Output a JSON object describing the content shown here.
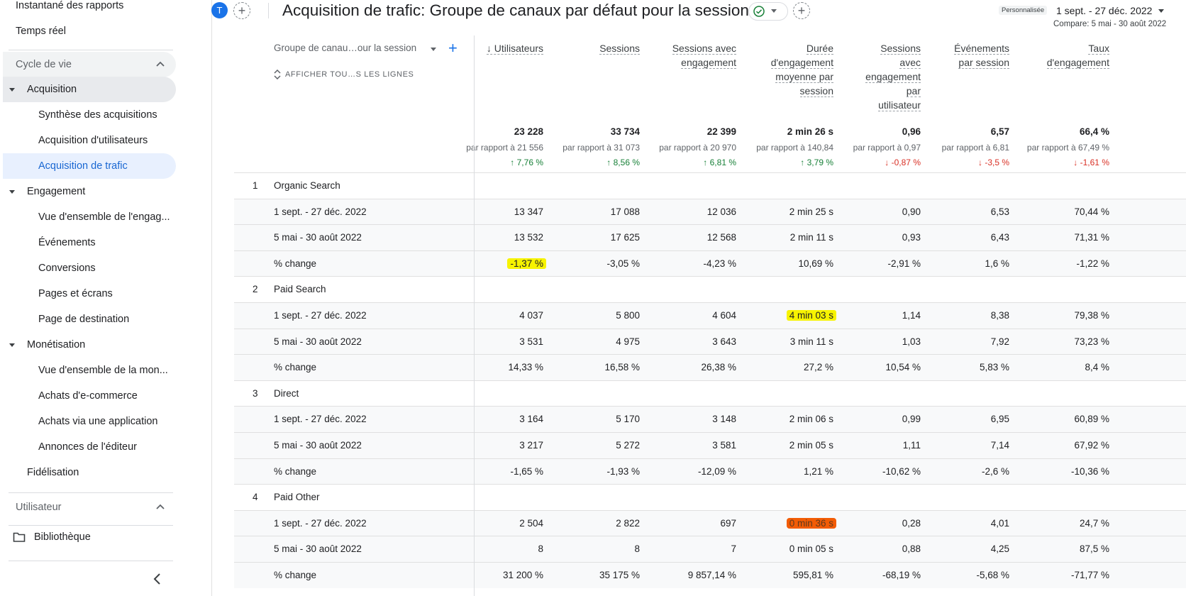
{
  "sidebar": {
    "top_items": [
      "Instantané des rapports",
      "Temps réel"
    ],
    "lifecycle_section": "Cycle de vie",
    "acquisition": "Acquisition",
    "acquisition_items": [
      "Synthèse des acquisitions",
      "Acquisition d'utilisateurs",
      "Acquisition de trafic"
    ],
    "engagement": "Engagement",
    "engagement_items": [
      "Vue d'ensemble de l'engag...",
      "Événements",
      "Conversions",
      "Pages et écrans",
      "Page de destination"
    ],
    "monetisation": "Monétisation",
    "monetisation_items": [
      "Vue d'ensemble de la mon...",
      "Achats d'e-commerce",
      "Achats via une application",
      "Annonces de l'éditeur"
    ],
    "fidelisation": "Fidélisation",
    "user_section": "Utilisateur",
    "library": "Bibliothèque"
  },
  "header": {
    "avatar_letter": "T",
    "title": "Acquisition de trafic: Groupe de canaux par défaut pour la session",
    "custom_chip": "Personnalisée",
    "date_range": "1 sept. - 27 déc. 2022",
    "compare": "Compare: 5 mai - 30 août 2022"
  },
  "table": {
    "dimension_header": "Groupe de canau…our la session",
    "show_all": "AFFICHER TOU…S LES LIGNES",
    "metrics": [
      {
        "lines": [
          "↓ Utilisateurs"
        ],
        "total": "23 228",
        "compare": "par rapport à 21 556",
        "delta": "↑ 7,76 %",
        "dir": "up"
      },
      {
        "lines": [
          "Sessions"
        ],
        "total": "33 734",
        "compare": "par rapport à 31 073",
        "delta": "↑ 8,56 %",
        "dir": "up"
      },
      {
        "lines": [
          "Sessions avec",
          "engagement"
        ],
        "total": "22 399",
        "compare": "par rapport à 20 970",
        "delta": "↑ 6,81 %",
        "dir": "up"
      },
      {
        "lines": [
          "Durée",
          "d'engagement",
          "moyenne par",
          "session"
        ],
        "total": "2 min 26 s",
        "compare": "par rapport à 140,84",
        "delta": "↑ 3,79 %",
        "dir": "up"
      },
      {
        "lines": [
          "Sessions",
          "avec",
          "engagement",
          "par",
          "utilisateur"
        ],
        "total": "0,96",
        "compare": "par rapport à 0,97",
        "delta": "↓ -0,87 %",
        "dir": "down"
      },
      {
        "lines": [
          "Événements",
          "par session"
        ],
        "total": "6,57",
        "compare": "par rapport à 6,81",
        "delta": "↓ -3,5 %",
        "dir": "down"
      },
      {
        "lines": [
          "Taux",
          "d'engagement"
        ],
        "total": "66,4 %",
        "compare": "par rapport à 67,49 %",
        "delta": "↓ -1,61 %",
        "dir": "down"
      }
    ],
    "groups": [
      {
        "num": "1",
        "name": "Organic Search",
        "rows": [
          {
            "label": "1 sept. - 27 déc. 2022",
            "values": [
              "13 347",
              "17 088",
              "12 036",
              "2 min 25 s",
              "0,90",
              "6,53",
              "70,44 %"
            ]
          },
          {
            "label": "5 mai - 30 août 2022",
            "values": [
              "13 532",
              "17 625",
              "12 568",
              "2 min 11 s",
              "0,93",
              "6,43",
              "71,31 %"
            ]
          },
          {
            "label": "% change",
            "values": [
              "-1,37 %",
              "-3,05 %",
              "-4,23 %",
              "10,69 %",
              "-2,91 %",
              "1,6 %",
              "-1,22 %"
            ]
          }
        ]
      },
      {
        "num": "2",
        "name": "Paid Search",
        "rows": [
          {
            "label": "1 sept. - 27 déc. 2022",
            "values": [
              "4 037",
              "5 800",
              "4 604",
              "4 min 03 s",
              "1,14",
              "8,38",
              "79,38 %"
            ]
          },
          {
            "label": "5 mai - 30 août 2022",
            "values": [
              "3 531",
              "4 975",
              "3 643",
              "3 min 11 s",
              "1,03",
              "7,92",
              "73,23 %"
            ]
          },
          {
            "label": "% change",
            "values": [
              "14,33 %",
              "16,58 %",
              "26,38 %",
              "27,2 %",
              "10,54 %",
              "5,83 %",
              "8,4 %"
            ]
          }
        ]
      },
      {
        "num": "3",
        "name": "Direct",
        "rows": [
          {
            "label": "1 sept. - 27 déc. 2022",
            "values": [
              "3 164",
              "5 170",
              "3 148",
              "2 min 06 s",
              "0,99",
              "6,95",
              "60,89 %"
            ]
          },
          {
            "label": "5 mai - 30 août 2022",
            "values": [
              "3 217",
              "5 272",
              "3 581",
              "2 min 05 s",
              "1,11",
              "7,14",
              "67,92 %"
            ]
          },
          {
            "label": "% change",
            "values": [
              "-1,65 %",
              "-1,93 %",
              "-12,09 %",
              "1,21 %",
              "-10,62 %",
              "-2,6 %",
              "-10,36 %"
            ]
          }
        ]
      },
      {
        "num": "4",
        "name": "Paid Other",
        "rows": [
          {
            "label": "1 sept. - 27 déc. 2022",
            "values": [
              "2 504",
              "2 822",
              "697",
              "0 min 36 s",
              "0,28",
              "4,01",
              "24,7 %"
            ]
          },
          {
            "label": "5 mai - 30 août 2022",
            "values": [
              "8",
              "8",
              "7",
              "0 min 05 s",
              "0,88",
              "4,25",
              "87,5 %"
            ]
          },
          {
            "label": "% change",
            "values": [
              "31 200 %",
              "35 175 %",
              "9 857,14 %",
              "595,81 %",
              "-68,19 %",
              "-5,68 %",
              "-71,77 %"
            ]
          }
        ]
      }
    ],
    "highlights": [
      {
        "group": 0,
        "row": 2,
        "col": 0,
        "color": "yellow"
      },
      {
        "group": 1,
        "row": 0,
        "col": 3,
        "color": "yellow"
      },
      {
        "group": 3,
        "row": 0,
        "col": 3,
        "color": "orange"
      }
    ]
  },
  "colors": {
    "accent": "#1a73e8",
    "active_bg": "#e8f0fe",
    "section_bg": "#f1f3f4",
    "up": "#188038",
    "down": "#d93025"
  }
}
